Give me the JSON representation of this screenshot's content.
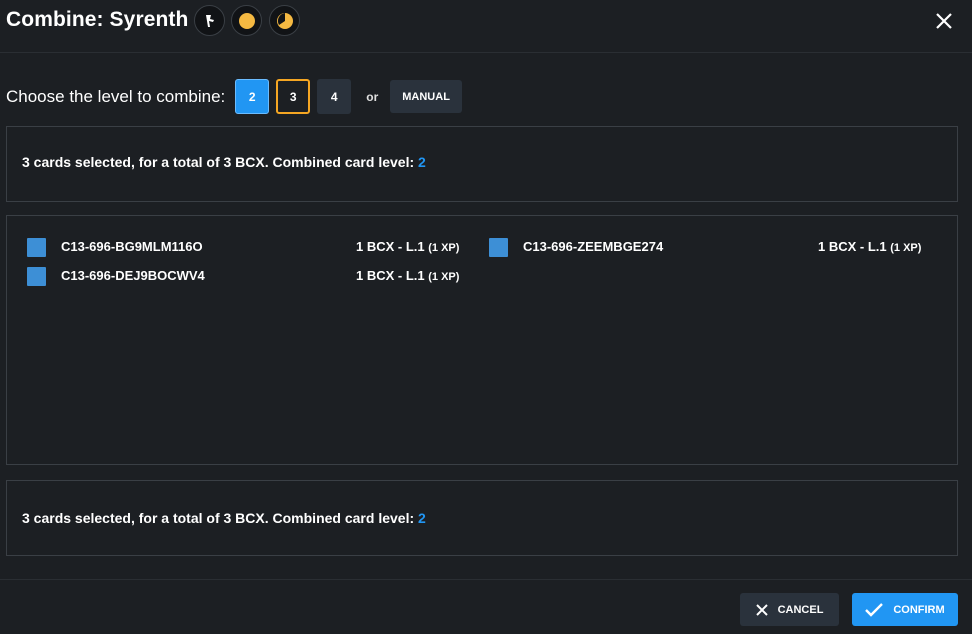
{
  "header": {
    "title": "Combine: Syrenth",
    "badges": [
      "runner-icon",
      "sun-icon",
      "moon-icon"
    ],
    "close_icon": "close-icon"
  },
  "level_selector": {
    "label": "Choose the level to combine:",
    "options": [
      "2",
      "3",
      "4"
    ],
    "selected": "2",
    "highlighted": "3",
    "or_text": "or",
    "manual_label": "MANUAL"
  },
  "summary": {
    "text": "3 cards selected, for a total of 3 BCX. Combined card level: ",
    "level": "2"
  },
  "cards": [
    {
      "id": "C13-696-BG9MLM116O",
      "bcx": "1 BCX - L.1",
      "xp": "(1 XP)"
    },
    {
      "id": "C13-696-ZEEMBGE274",
      "bcx": "1 BCX - L.1",
      "xp": "(1 XP)"
    },
    {
      "id": "C13-696-DEJ9BOCWV4",
      "bcx": "1 BCX - L.1",
      "xp": "(1 XP)"
    }
  ],
  "footer": {
    "cancel_label": "CANCEL",
    "confirm_label": "CONFIRM"
  },
  "colors": {
    "background": "#1c1f23",
    "accent": "#2196f3",
    "highlight": "#f5a623",
    "checkbox": "#3d8fd6"
  }
}
